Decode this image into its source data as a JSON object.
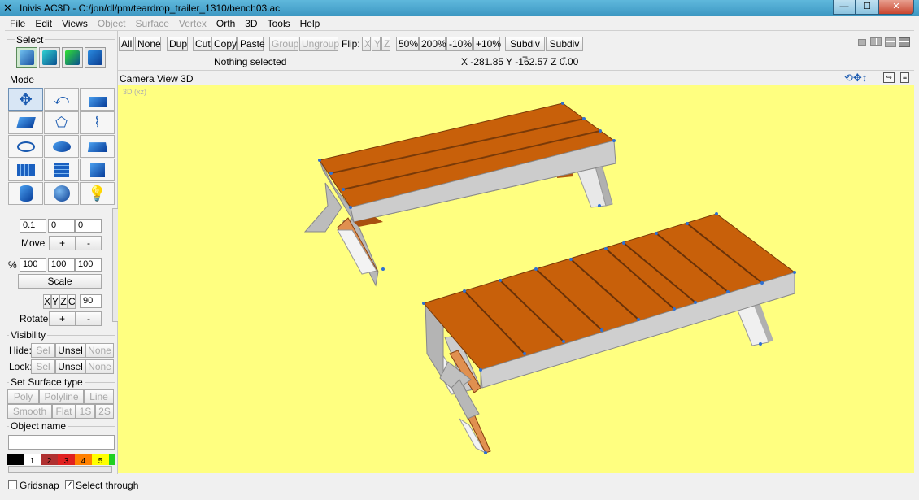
{
  "window": {
    "title": "Inivis AC3D - C:/jon/dl/pm/teardrop_trailer_1310/bench03.ac",
    "app_icon": "ac3d-logo-icon",
    "controls": [
      "minimize",
      "maximize",
      "close"
    ]
  },
  "menu": [
    "File",
    "Edit",
    "Views",
    "Object",
    "Surface",
    "Vertex",
    "Orth",
    "3D",
    "Tools",
    "Help"
  ],
  "menu_disabled": [
    "Object",
    "Surface",
    "Vertex"
  ],
  "panel": {
    "select_label": "Select",
    "mode_label": "Mode",
    "move": {
      "x": "0.1",
      "y": "0",
      "z": "0",
      "label": "Move",
      "plus": "+",
      "minus": "-"
    },
    "scale": {
      "pct": "%",
      "x": "100",
      "y": "100",
      "z": "100",
      "label": "Scale"
    },
    "rotate": {
      "x": "X",
      "y": "Y",
      "z": "Z",
      "c": "C",
      "angle": "90",
      "label": "Rotate",
      "plus": "+",
      "minus": "-"
    },
    "visibility": {
      "label": "Visibility",
      "hide_label": "Hide:",
      "lock_label": "Lock:",
      "sel": "Sel",
      "unsel": "Unsel",
      "none": "None"
    },
    "surface": {
      "label": "Set Surface type",
      "poly": "Poly",
      "polyline": "Polyline",
      "line": "Line",
      "smooth": "Smooth",
      "flat": "Flat",
      "s1": "1S",
      "s2": "2S"
    },
    "object_name_label": "Object name",
    "object_name_value": "",
    "palette": [
      {
        "num": "",
        "color": "#000000"
      },
      {
        "num": "1",
        "color": "#ffffff"
      },
      {
        "num": "2",
        "color": "#b03030"
      },
      {
        "num": "3",
        "color": "#e02020"
      },
      {
        "num": "4",
        "color": "#ff8000"
      },
      {
        "num": "5",
        "color": "#ffff00"
      },
      {
        "num": "",
        "color": "#20d020"
      }
    ]
  },
  "toolbar": {
    "all": "All",
    "none": "None",
    "dup": "Dup",
    "cut": "Cut",
    "copy": "Copy",
    "paste": "Paste",
    "group": "Group",
    "ungroup": "Ungroup",
    "flip": "Flip:",
    "fx": "X",
    "fy": "Y",
    "fz": "Z",
    "z50": "50%",
    "z200": "200%",
    "m10": "-10%",
    "p10": "+10%",
    "subdiv_plus": "Subdiv +",
    "subdiv_minus": "Subdiv -"
  },
  "status": {
    "selection": "Nothing selected",
    "coords": "X -281.85 Y -162.57 Z 0.00"
  },
  "view": {
    "title": "Camera View 3D",
    "corner_label": "3D (xz)"
  },
  "footer": {
    "gridsnap": "Gridsnap",
    "gridsnap_checked": false,
    "select_through": "Select through",
    "select_through_checked": true
  },
  "colors": {
    "viewport_bg": "#ffff80",
    "wood_top": "#c8600a",
    "wood_dark": "#8a4010",
    "frame": "#c8c8c8",
    "vertex": "#3070d0"
  }
}
